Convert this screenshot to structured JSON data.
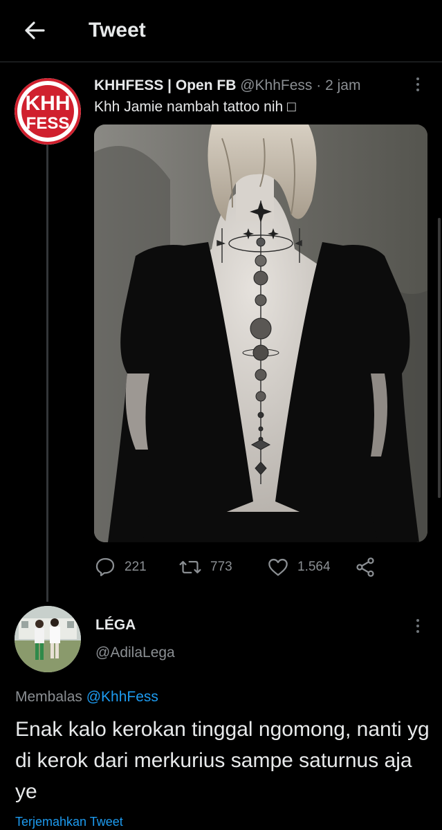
{
  "header": {
    "title": "Tweet",
    "back_icon": "arrow-left-icon"
  },
  "tweet": {
    "author_name": "KHHFESS | Open FB",
    "author_handle": "@KhhFess",
    "time": "· 2 jam",
    "text": "Khh Jamie nambah tattoo nih □",
    "avatar_text_top": "KHH",
    "avatar_text_bottom": "FESS",
    "actions": {
      "replies": "221",
      "retweets": "773",
      "likes": "1.564"
    }
  },
  "reply": {
    "author_name": "LÉGA",
    "author_handle": "@AdilaLega",
    "replying_prefix": "Membalas",
    "replying_to": "@KhhFess",
    "text": "Enak kalo kerokan tinggal ngomong, nanti yg di kerok dari merkurius sampe saturnus aja ye",
    "translate_label": "Terjemahkan Tweet"
  },
  "colors": {
    "background": "#000000",
    "text": "#e7e9ea",
    "secondary": "#8b8f93",
    "accent": "#1d9bf0",
    "brand_red": "#d0202e"
  }
}
